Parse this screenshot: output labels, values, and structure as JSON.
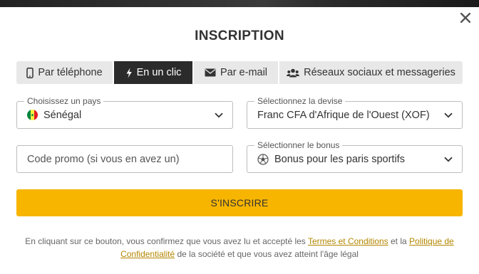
{
  "modal": {
    "title": "INSCRIPTION",
    "close_icon": "close-icon"
  },
  "tabs": [
    {
      "label": "Par téléphone",
      "icon": "phone-icon",
      "active": false
    },
    {
      "label": "En un clic",
      "icon": "lightning-icon",
      "active": true
    },
    {
      "label": "Par e-mail",
      "icon": "envelope-icon",
      "active": false
    },
    {
      "label": "Réseaux sociaux et messageries",
      "icon": "users-icon",
      "active": false
    }
  ],
  "country": {
    "legend": "Choisissez un pays",
    "value": "Sénégal",
    "flag": "senegal-flag-icon"
  },
  "currency": {
    "legend": "Sélectionnez la devise",
    "value": "Franc CFA d'Afrique de l'Ouest (XOF)"
  },
  "promo": {
    "placeholder": "Code promo (si vous en avez un)"
  },
  "bonus": {
    "legend": "Sélectionner le bonus",
    "value": "Bonus pour les paris sportifs",
    "icon": "soccer-ball-icon"
  },
  "submit": {
    "label": "S'INSCRIRE"
  },
  "legal": {
    "before": "En cliquant sur ce bouton, vous confirmez que vous avez lu et accepté les ",
    "terms_link": "Termes et Conditions",
    "middle": " et la ",
    "privacy_link": "Politique de Confidentialité",
    "after": " de la société et que vous avez atteint l'âge légal"
  },
  "colors": {
    "accent": "#f7b500",
    "active_tab": "#2b2b2b",
    "tab_bg": "#e8e8e8",
    "link": "#b38600"
  }
}
